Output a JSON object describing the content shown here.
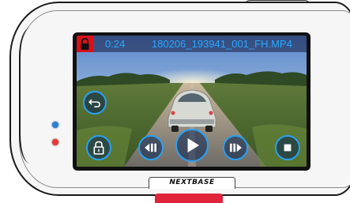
{
  "playback": {
    "elapsed_time": "0:24",
    "file_name": "180206_193941_001_FH.MP4",
    "state": "paused"
  },
  "brand": {
    "logo_text": "NEXTBASE"
  },
  "icons": {
    "lock_badge": "lock-icon",
    "back": "back-arrow-icon",
    "protect": "lock-icon",
    "prev": "skip-back-icon",
    "play": "play-icon",
    "next": "skip-forward-icon",
    "stop": "stop-icon"
  },
  "colors": {
    "accent": "#2aa8ff",
    "lock_badge": "#d8101a",
    "led_blue": "#2c7fd6",
    "led_red": "#e23a3a",
    "shutter_button": "#e0233a"
  }
}
